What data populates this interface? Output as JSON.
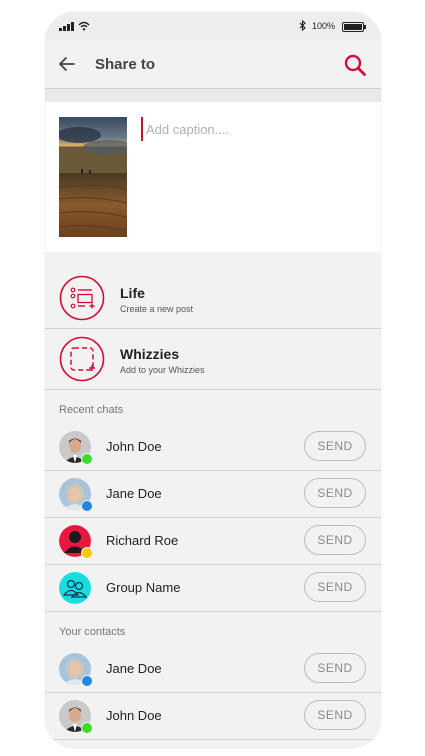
{
  "status_bar": {
    "battery": "100%"
  },
  "header": {
    "title": "Share to"
  },
  "caption": {
    "placeholder": "Add caption...."
  },
  "share_options": [
    {
      "title": "Life",
      "subtitle": "Create a new post"
    },
    {
      "title": "Whizzies",
      "subtitle": "Add to your Whizzies"
    }
  ],
  "recent_chats": {
    "label": "Recent chats",
    "items": [
      {
        "name": "John Doe",
        "send_label": "SEND",
        "status_color": "#3ddc2a"
      },
      {
        "name": "Jane Doe",
        "send_label": "SEND",
        "status_color": "#1e88e5"
      },
      {
        "name": "Richard Roe",
        "send_label": "SEND",
        "status_color": "#f6c90e"
      },
      {
        "name": "Group Name",
        "send_label": "SEND"
      }
    ]
  },
  "contacts": {
    "label": "Your contacts",
    "items": [
      {
        "name": "Jane Doe",
        "send_label": "SEND",
        "status_color": "#1e88e5"
      },
      {
        "name": "John Doe",
        "send_label": "SEND",
        "status_color": "#3ddc2a"
      }
    ]
  },
  "colors": {
    "accent": "#d0103a"
  }
}
